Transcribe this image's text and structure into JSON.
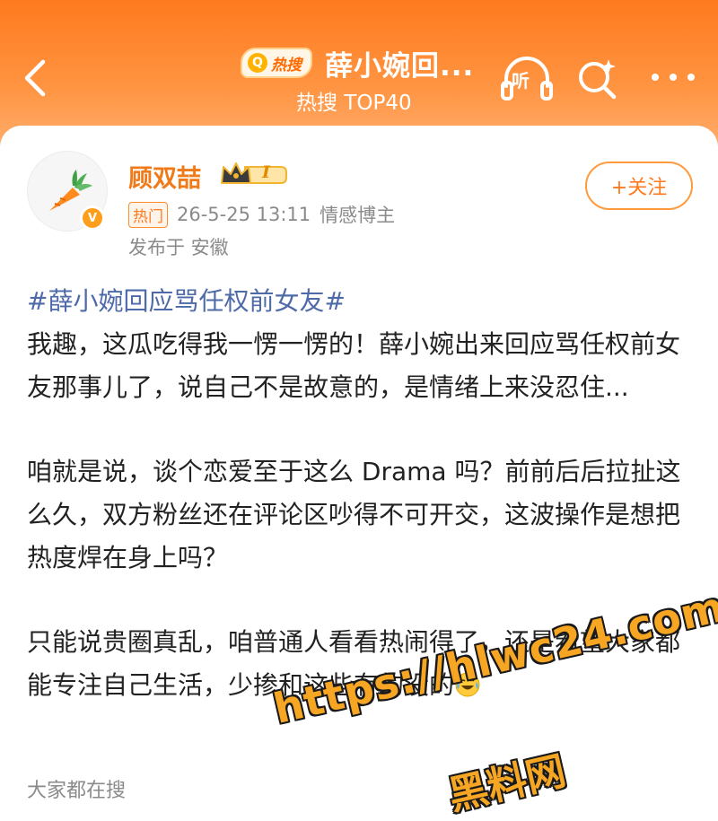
{
  "header": {
    "hot_badge_label": "热搜",
    "title": "薛小婉回...",
    "subtitle": "热搜 TOP40",
    "listen_label": "听"
  },
  "post": {
    "author": {
      "name": "顾双喆",
      "level": "I"
    },
    "tag": "热门",
    "timestamp": "26-5-25 13:11",
    "author_role": "情感博主",
    "location": "发布于 安徽",
    "follow_label": "+关注",
    "hashtag": "#薛小婉回应骂任权前女友#",
    "paragraphs": [
      "我趣，这瓜吃得我一愣一愣的！薛小婉出来回应骂任权前女友那事儿了，说自己不是故意的，是情绪上来没忍住...",
      "咱就是说，谈个恋爱至于这么 Drama 吗？前前后后拉扯这么久，双方粉丝还在评论区吵得不可开交，这波操作是想把热度焊在身上吗？",
      "只能说贵圈真乱，咱普通人看看热闹得了，还是希望大家都能专注自己生活，少掺和这些有的没的"
    ]
  },
  "footer": {
    "section_label": "大家都在搜"
  },
  "watermark": {
    "url": "https://hlwc24.com",
    "brand": "黑料网"
  },
  "colors": {
    "header_orange": "#ff7a1f",
    "username_orange": "#f07a18",
    "hashtag_blue": "#4e6aa8"
  }
}
